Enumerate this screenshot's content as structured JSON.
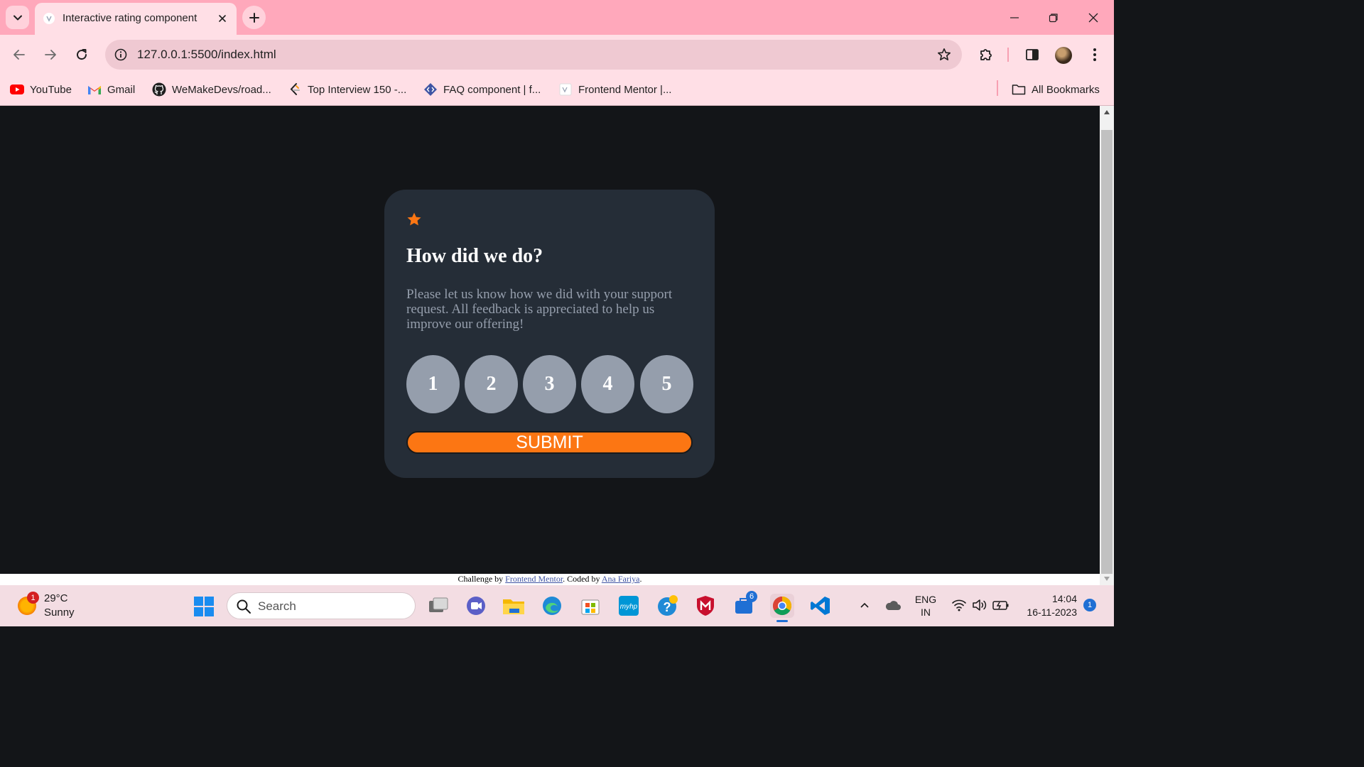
{
  "browser": {
    "tab": {
      "title": "Interactive rating component"
    },
    "address": {
      "url": "127.0.0.1:5500/index.html"
    },
    "bookmarks": [
      {
        "label": "YouTube",
        "icon": "youtube-icon"
      },
      {
        "label": "Gmail",
        "icon": "gmail-icon"
      },
      {
        "label": "WeMakeDevs/road...",
        "icon": "github-icon"
      },
      {
        "label": "Top Interview 150 -...",
        "icon": "leetcode-icon"
      },
      {
        "label": "FAQ component | f...",
        "icon": "frontend-mentor-icon"
      },
      {
        "label": "Frontend Mentor |...",
        "icon": "page-icon"
      }
    ],
    "all_bookmarks_label": "All Bookmarks"
  },
  "card": {
    "icon": "star-icon",
    "accent_color": "#fc7613",
    "title": "How did we do?",
    "description": "Please let us know how we did with your support request. All feedback is appreciated to help us improve our offering!",
    "ratings": [
      "1",
      "2",
      "3",
      "4",
      "5"
    ],
    "submit_label": "SUBMIT"
  },
  "footer": {
    "prefix": "Challenge by ",
    "link1": "Frontend Mentor",
    "middle": ". Coded by ",
    "link2": "Ana Fariya",
    "suffix": "."
  },
  "taskbar": {
    "weather": {
      "temp": "29°C",
      "condition": "Sunny",
      "badge": "1"
    },
    "search_placeholder": "Search",
    "store_badge": "6",
    "language": {
      "line1": "ENG",
      "line2": "IN"
    },
    "time": "14:04",
    "date": "16-11-2023",
    "notification_count": "1"
  }
}
